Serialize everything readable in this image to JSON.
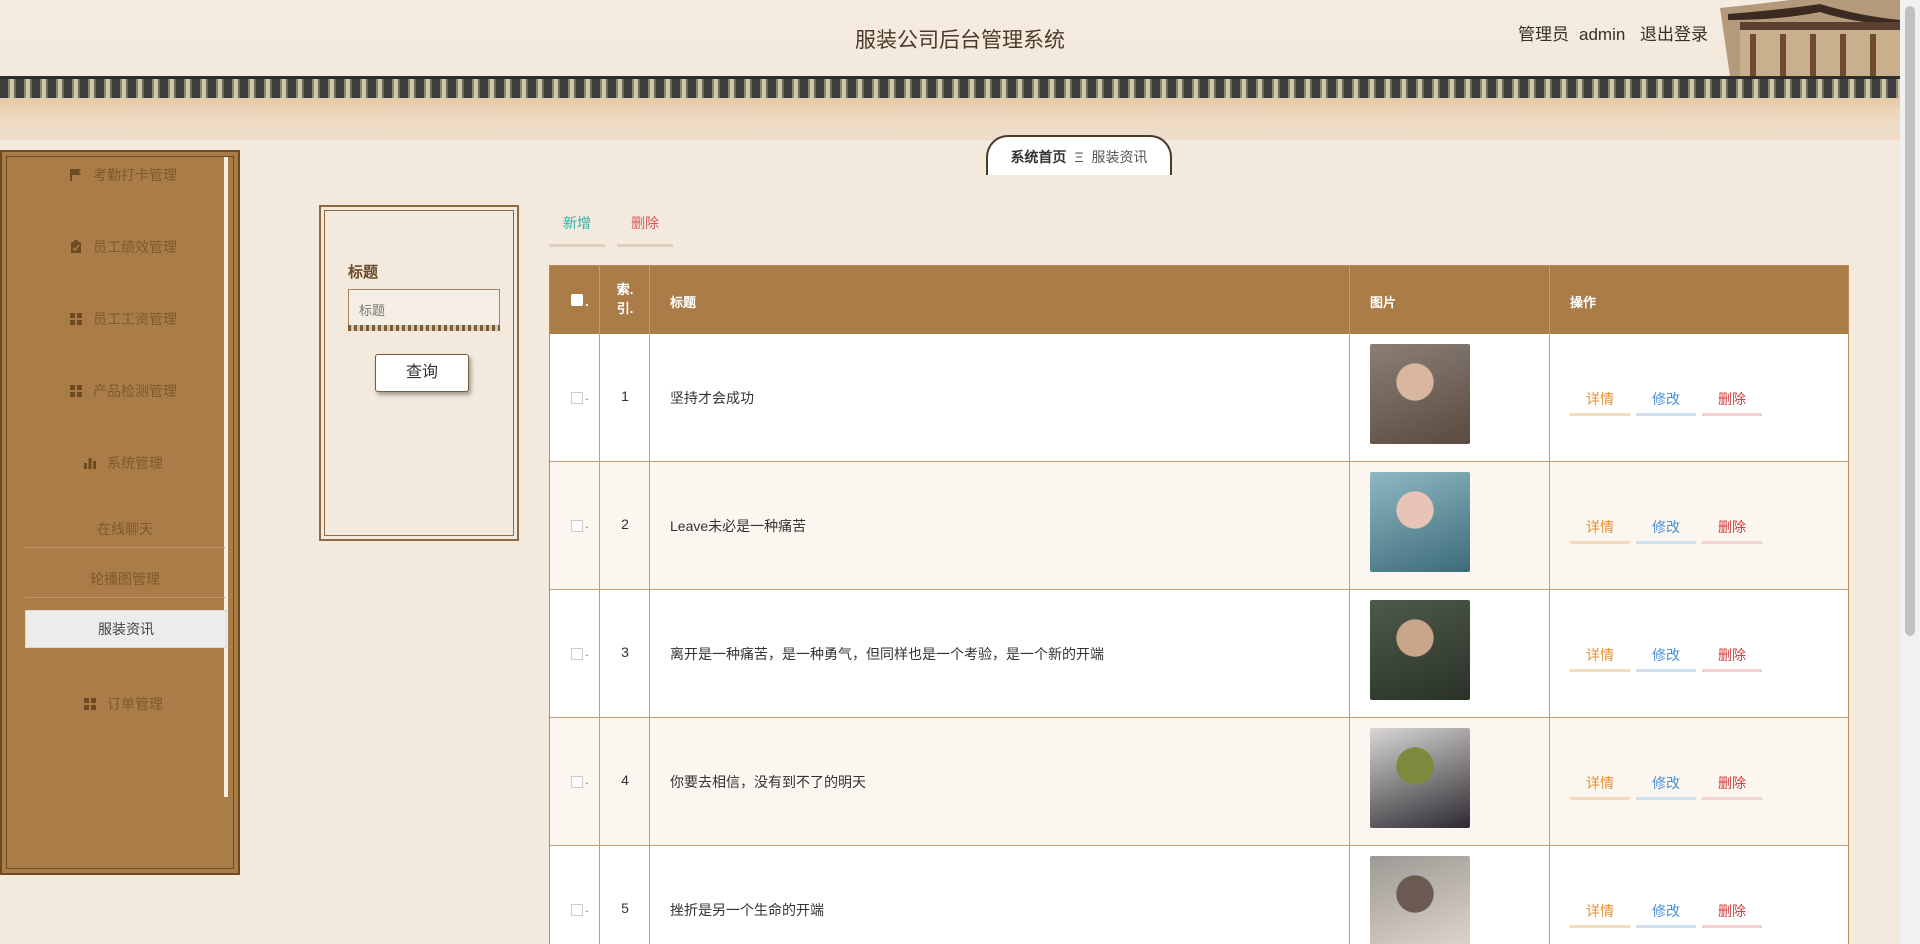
{
  "header": {
    "title": "服装公司后台管理系统",
    "user_role": "管理员",
    "user_name": "admin",
    "logout_label": "退出登录"
  },
  "sidebar": {
    "items": [
      {
        "label": "考勤打卡管理",
        "icon": "flag-icon"
      },
      {
        "label": "员工绩效管理",
        "icon": "clipboard-icon"
      },
      {
        "label": "员工工资管理",
        "icon": "grid-icon"
      },
      {
        "label": "产品检测管理",
        "icon": "grid-icon"
      },
      {
        "label": "系统管理",
        "icon": "bar-chart-icon"
      }
    ],
    "sub_items": [
      "在线聊天",
      "轮播图管理",
      "服装资讯"
    ],
    "active_sub": "服装资讯",
    "last_item": {
      "label": "订单管理",
      "icon": "grid-icon"
    }
  },
  "breadcrumb": {
    "home": "系统首页",
    "separator": "Ξ",
    "current": "服装资讯"
  },
  "search": {
    "label": "标题",
    "placeholder": "标题",
    "button": "查询"
  },
  "actions": {
    "add": "新增",
    "delete": "删除"
  },
  "table": {
    "headers": {
      "check_dot": ".",
      "index": "索.\n引.",
      "title": "标题",
      "image": "图片",
      "ops": "操作"
    },
    "rows": [
      {
        "index": "1",
        "title": "坚持才会成功",
        "thumb_colors": [
          "#8a7f76",
          "#d9b6a0",
          "#5a4a3f"
        ]
      },
      {
        "index": "2",
        "title": "Leave未必是一种痛苦",
        "thumb_colors": [
          "#8fb8c2",
          "#e8c4b6",
          "#3d6b7a"
        ]
      },
      {
        "index": "3",
        "title": "离开是一种痛苦，是一种勇气，但同样也是一个考验，是一个新的开端",
        "thumb_colors": [
          "#4d5a4a",
          "#c9a58a",
          "#2a3228"
        ]
      },
      {
        "index": "4",
        "title": "你要去相信，没有到不了的明天",
        "thumb_colors": [
          "#dad7d6",
          "#7b8a3c",
          "#2c2a30"
        ]
      },
      {
        "index": "5",
        "title": "挫折是另一个生命的开端",
        "thumb_colors": [
          "#9c9994",
          "#6b5a52",
          "#e4d8cf"
        ]
      }
    ],
    "op_labels": {
      "detail": "详情",
      "edit": "修改",
      "remove": "删除"
    },
    "row_check_dot": "."
  }
}
